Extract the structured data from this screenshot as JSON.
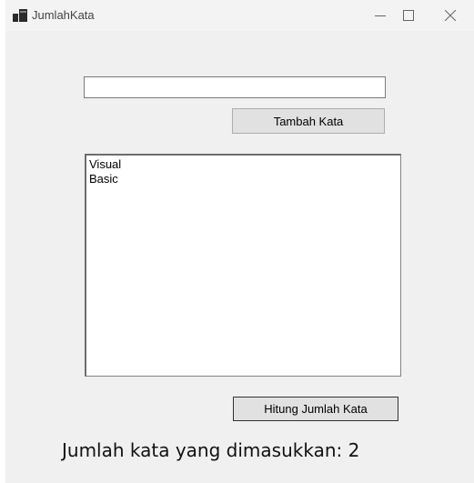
{
  "window": {
    "title": "JumlahKata",
    "icon": "app-window-icon",
    "controls": [
      "minimize-icon",
      "maximize-icon",
      "close-icon"
    ]
  },
  "input": {
    "value": "",
    "placeholder": ""
  },
  "buttons": {
    "add_word": "Tambah Kata",
    "count_words": "Hitung Jumlah Kata"
  },
  "word_list": {
    "items": [
      "Visual",
      "Basic"
    ]
  },
  "result": {
    "text": "Jumlah kata yang dimasukkan: 2"
  }
}
